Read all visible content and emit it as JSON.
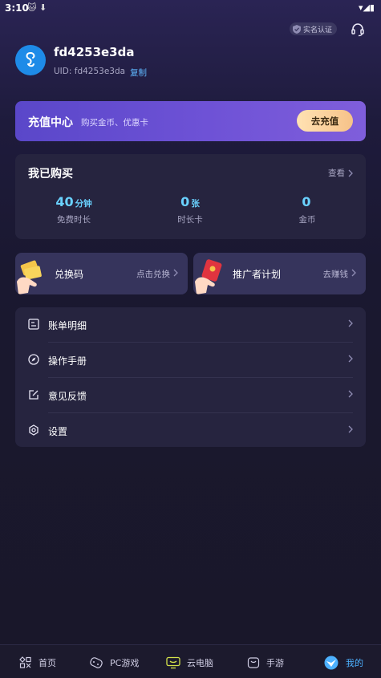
{
  "status_bar": {
    "time": "3:10",
    "left_icons": "🐱 ⬇",
    "right_icons": "▾◢▮"
  },
  "header": {
    "verify_badge": "实名认证",
    "support_icon": "headset-icon"
  },
  "profile": {
    "username": "fd4253e3da",
    "uid_label": "UID: fd4253e3da",
    "copy_label": "复制"
  },
  "recharge": {
    "title": "充值中心",
    "subtitle": "购买金币、优惠卡",
    "button": "去充值"
  },
  "purchased": {
    "title": "我已购买",
    "view_label": "查看",
    "stats": [
      {
        "value": "40",
        "unit": "分钟",
        "label": "免费时长"
      },
      {
        "value": "0",
        "unit": "张",
        "label": "时长卡"
      },
      {
        "value": "0",
        "unit": "",
        "label": "金币"
      }
    ]
  },
  "promo_cards": [
    {
      "title": "兑换码",
      "action": "点击兑换"
    },
    {
      "title": "推广者计划",
      "action": "去赚钱"
    }
  ],
  "menu": [
    {
      "label": "账单明细",
      "icon": "bill-icon"
    },
    {
      "label": "操作手册",
      "icon": "compass-icon"
    },
    {
      "label": "意见反馈",
      "icon": "edit-icon"
    },
    {
      "label": "设置",
      "icon": "gear-icon"
    }
  ],
  "tabbar": [
    {
      "label": "首页",
      "icon": "home-grid-icon",
      "active": false
    },
    {
      "label": "PC游戏",
      "icon": "gamepad-icon",
      "active": false
    },
    {
      "label": "云电脑",
      "icon": "cloud-pc-icon",
      "active": false
    },
    {
      "label": "手游",
      "icon": "mobile-game-icon",
      "active": false
    },
    {
      "label": "我的",
      "icon": "me-icon",
      "active": true
    }
  ],
  "colors": {
    "accent": "#4db1ff",
    "stat": "#6ad2ff",
    "recharge_gradient_start": "#5a47c9",
    "recharge_button": "#f6c289"
  }
}
